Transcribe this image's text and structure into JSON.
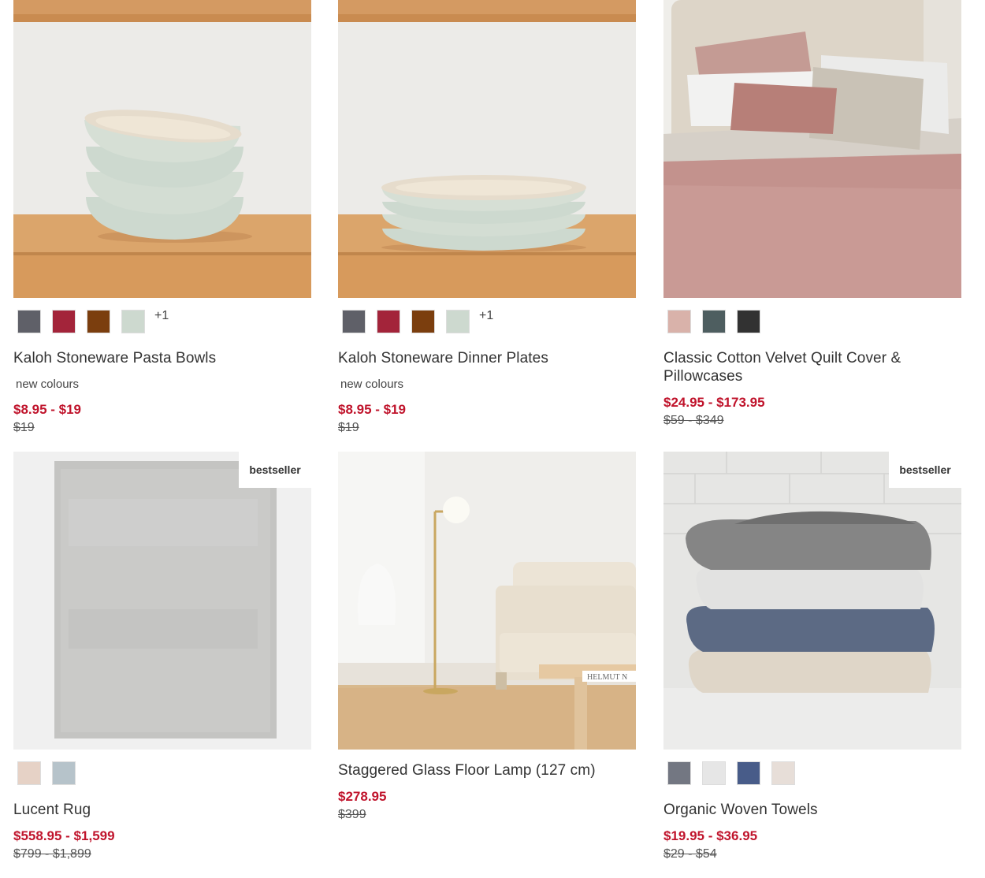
{
  "products": [
    {
      "name": "Kaloh Stoneware Pasta Bowls",
      "tag": "new colours",
      "price": "$8.95 - $19",
      "original_price": "$19",
      "more_swatches": "+1",
      "swatches": [
        "#5f6068",
        "#a3243a",
        "#7b3e0e",
        "#cdd9cf"
      ]
    },
    {
      "name": "Kaloh Stoneware Dinner Plates",
      "tag": "new colours",
      "price": "$8.95 - $19",
      "original_price": "$19",
      "more_swatches": "+1",
      "swatches": [
        "#5f6068",
        "#a3243a",
        "#7b3e0e",
        "#cdd9cf"
      ]
    },
    {
      "name": "Classic Cotton Velvet Quilt Cover & Pillowcases",
      "price": "$24.95 - $173.95",
      "original_price": "$59 - $349",
      "swatches": [
        "#d9b2aa",
        "#4e5e60",
        "#323232"
      ]
    },
    {
      "name": "Lucent Rug",
      "badge": "bestseller",
      "price": "$558.95 - $1,599",
      "original_price": "$799 - $1,899",
      "swatches": [
        "#e6d2c6",
        "#b6c3ca"
      ]
    },
    {
      "name": "Staggered Glass Floor Lamp (127 cm)",
      "price": "$278.95",
      "original_price": "$399",
      "image_text": "HELMUT N"
    },
    {
      "name": "Organic Woven Towels",
      "badge": "bestseller",
      "price": "$19.95 - $36.95",
      "original_price": "$29 - $54",
      "swatches": [
        "#737782",
        "#e6e6e6",
        "#485c89",
        "#e7ded8"
      ]
    }
  ]
}
